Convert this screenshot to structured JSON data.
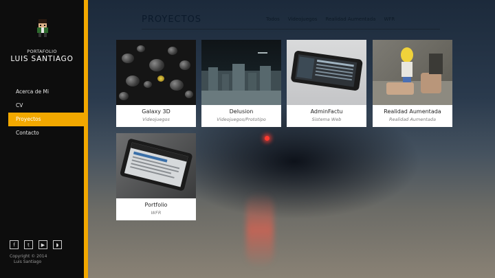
{
  "sidebar": {
    "portfolio_label": "PORTAFOLIO",
    "name": "LUIS SANTIAGO",
    "nav": [
      {
        "label": "Acerca de Mi",
        "active": false
      },
      {
        "label": "CV",
        "active": false
      },
      {
        "label": "Proyectos",
        "active": true
      },
      {
        "label": "Contacto",
        "active": false
      }
    ],
    "social": [
      {
        "icon": "facebook-icon",
        "glyph": "f"
      },
      {
        "icon": "twitter-icon",
        "glyph": "t"
      },
      {
        "icon": "youtube-icon",
        "glyph": "▶"
      },
      {
        "icon": "rss-icon",
        "glyph": "◗"
      }
    ],
    "copyright": "Copyright © 2014",
    "copyright_name": "Luis Santiago"
  },
  "header": {
    "title": "PROYECTOS",
    "filters": [
      "Todos",
      "Videojuegos",
      "Realidad Aumentada",
      "WFR"
    ]
  },
  "projects": [
    {
      "title": "Galaxy 3D",
      "category": "Videojuegos"
    },
    {
      "title": "Delusion",
      "category": "Videojuegos/Prototipo"
    },
    {
      "title": "AdminFactu",
      "category": "Sistema Web"
    },
    {
      "title": "Realidad Aumentada",
      "category": "Realidad Aumentada"
    },
    {
      "title": "Portfolio",
      "category": "WFR"
    }
  ],
  "colors": {
    "accent": "#f2a800",
    "sidebar_bg": "#0d0d0d"
  }
}
